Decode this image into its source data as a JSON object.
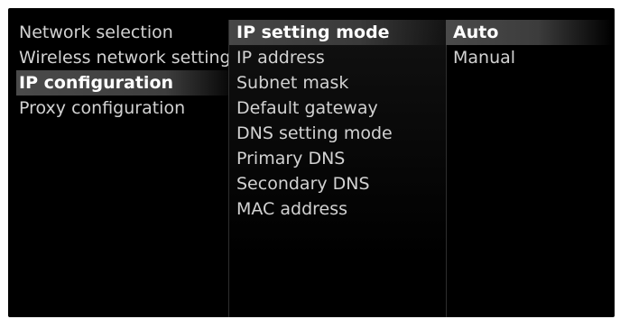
{
  "left_menu": {
    "items": [
      {
        "label": "Network selection",
        "selected": false
      },
      {
        "label": "Wireless network setting",
        "selected": false
      },
      {
        "label": "IP configuration",
        "selected": true
      },
      {
        "label": "Proxy configuration",
        "selected": false
      }
    ]
  },
  "middle_menu": {
    "items": [
      {
        "label": "IP setting mode",
        "selected": true
      },
      {
        "label": "IP address",
        "selected": false
      },
      {
        "label": "Subnet mask",
        "selected": false
      },
      {
        "label": "Default gateway",
        "selected": false
      },
      {
        "label": "DNS setting mode",
        "selected": false
      },
      {
        "label": "Primary DNS",
        "selected": false
      },
      {
        "label": "Secondary DNS",
        "selected": false
      },
      {
        "label": "MAC address",
        "selected": false
      }
    ]
  },
  "right_menu": {
    "items": [
      {
        "label": "Auto",
        "selected": true
      },
      {
        "label": "Manual",
        "selected": false
      }
    ]
  },
  "colors": {
    "background": "#000000",
    "highlight": "#474747",
    "text": "#d2d2d2",
    "text_selected": "#ffffff"
  }
}
